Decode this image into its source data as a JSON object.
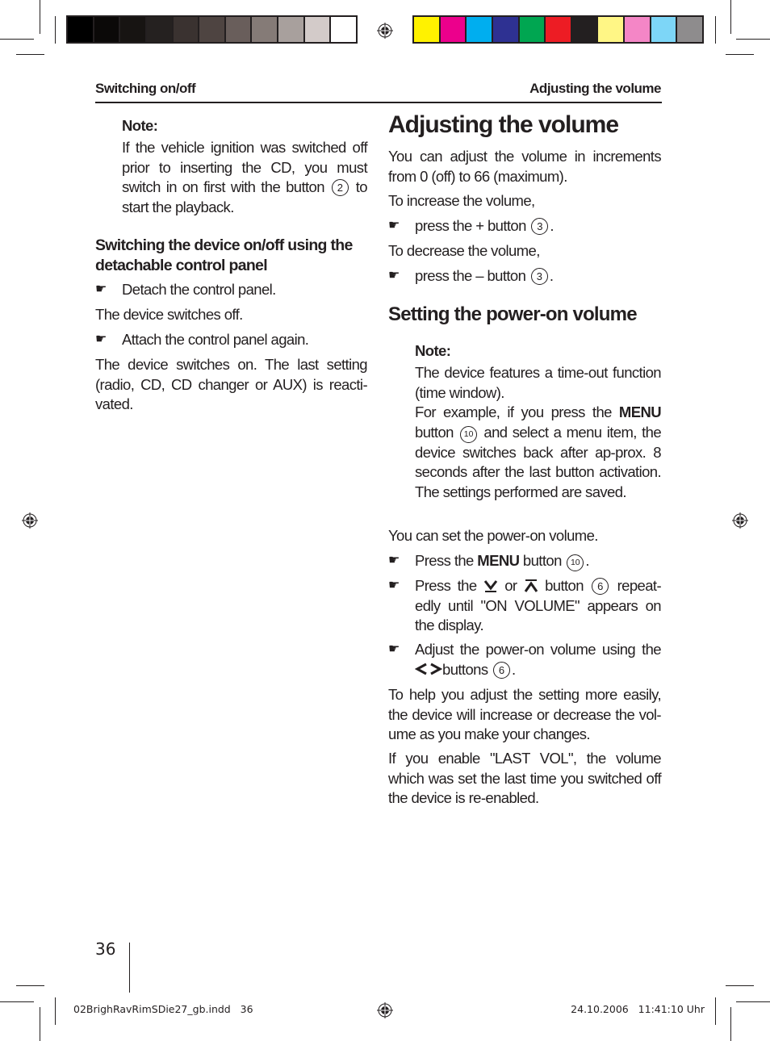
{
  "color_bar_left": [
    "#000000",
    "#0b0908",
    "#171412",
    "#252120",
    "#3a3230",
    "#4e4441",
    "#695e5b",
    "#857b77",
    "#a8a09d",
    "#d3cbc9",
    "#ffffff"
  ],
  "color_bar_right": [
    "#fff200",
    "#ec008c",
    "#00aeef",
    "#2e3192",
    "#00a651",
    "#ed1c24",
    "#231f20",
    "#fff685",
    "#f486c6",
    "#7dd6f7",
    "#8e8c8d"
  ],
  "header": {
    "left": "Switching on/off",
    "right": "Adjusting the volume"
  },
  "left_col": {
    "note_label": "Note:",
    "note_text_1": "If the vehicle ignition was switched off prior to inserting the CD, you must switch in on first with the button",
    "note_button": "2",
    "note_text_2": "to start the playback.",
    "section_heading": "Switching the device on/off using the detachable control panel",
    "step1": "Detach the control panel.",
    "result1": "The device switches off.",
    "step2": "Attach the control panel again.",
    "result2": "The device switches on. The last setting (radio, CD, CD changer or AUX) is reacti-vated."
  },
  "right_col": {
    "title": "Adjusting the volume",
    "intro": "You can adjust the volume in increments from 0 (off) to 66 (maximum).",
    "increase_label": "To increase the volume,",
    "increase_step": "press the + button",
    "increase_button": "3",
    "decrease_label": "To decrease the volume,",
    "decrease_step": "press the – button",
    "decrease_button": "3",
    "subheading": "Setting the power-on volume",
    "note_label": "Note:",
    "note_p1": "The device features a time-out function (time window).",
    "note_p2a": "For example, if you press the",
    "note_p2_menu": "MENU",
    "note_p2b": "button",
    "note_p2_btn": "10",
    "note_p2c": "and select a menu item, the device switches back after ap-prox. 8 seconds after the last button activation. The settings performed are saved.",
    "set_intro": "You can set the power-on volume.",
    "step1a": "Press the",
    "step1_menu": "MENU",
    "step1b": "button",
    "step1_btn": "10",
    "step2a": "Press the",
    "step2_or": "or",
    "step2b": "button",
    "step2_btn": "6",
    "step2c": "repeat-edly until \"ON VOLUME\" appears on the display.",
    "step3a": "Adjust the power-on volume using the",
    "step3b": "buttons",
    "step3_btn": "6",
    "para1": "To help you adjust the setting more easily, the device will increase or decrease the vol-ume as you make your changes.",
    "para2": "If you enable \"LAST VOL\", the volume which was set the last time you switched off the device is re-enabled."
  },
  "page_number": "36",
  "footer": {
    "file": "02BrighRavRimSDie27_gb.indd   36",
    "timestamp": "24.10.2006   11:41:10 Uhr"
  }
}
